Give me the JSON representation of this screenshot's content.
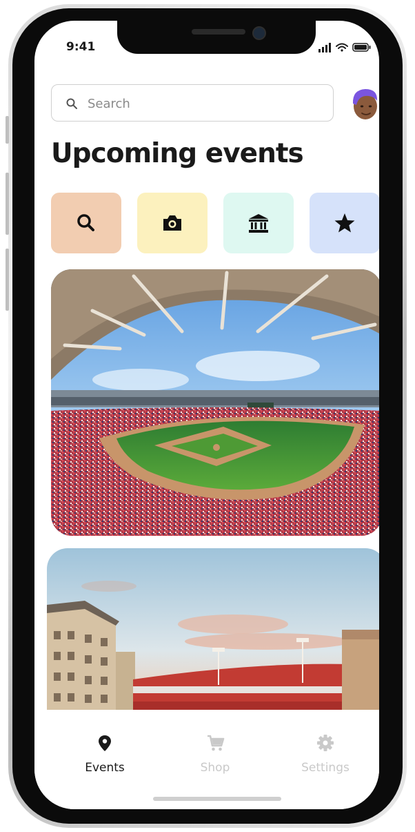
{
  "status_bar": {
    "time": "9:41"
  },
  "search": {
    "placeholder": "Search"
  },
  "header": {
    "title": "Upcoming events"
  },
  "categories": [
    {
      "icon": "search-icon",
      "color": "#F2CDB1"
    },
    {
      "icon": "camera-icon",
      "color": "#FCF1BE"
    },
    {
      "icon": "bank-icon",
      "color": "#DEF8F1"
    },
    {
      "icon": "star-icon",
      "color": "#D6E2FA"
    }
  ],
  "events": [
    {
      "image": "baseball-stadium-panorama-image"
    },
    {
      "image": "football-stadium-sunset-image"
    }
  ],
  "tab_bar": {
    "tabs": [
      {
        "label": "Events",
        "icon": "location-pin-icon",
        "active": true
      },
      {
        "label": "Shop",
        "icon": "cart-icon",
        "active": false
      },
      {
        "label": "Settings",
        "icon": "gear-icon",
        "active": false
      }
    ],
    "active_color": "#1a1a1a",
    "inactive_color": "#c9c9c9"
  },
  "colors": {
    "title": "#1a1a1a",
    "frame": "#0b0b0b",
    "avatar_hair": "#7A55E0"
  }
}
